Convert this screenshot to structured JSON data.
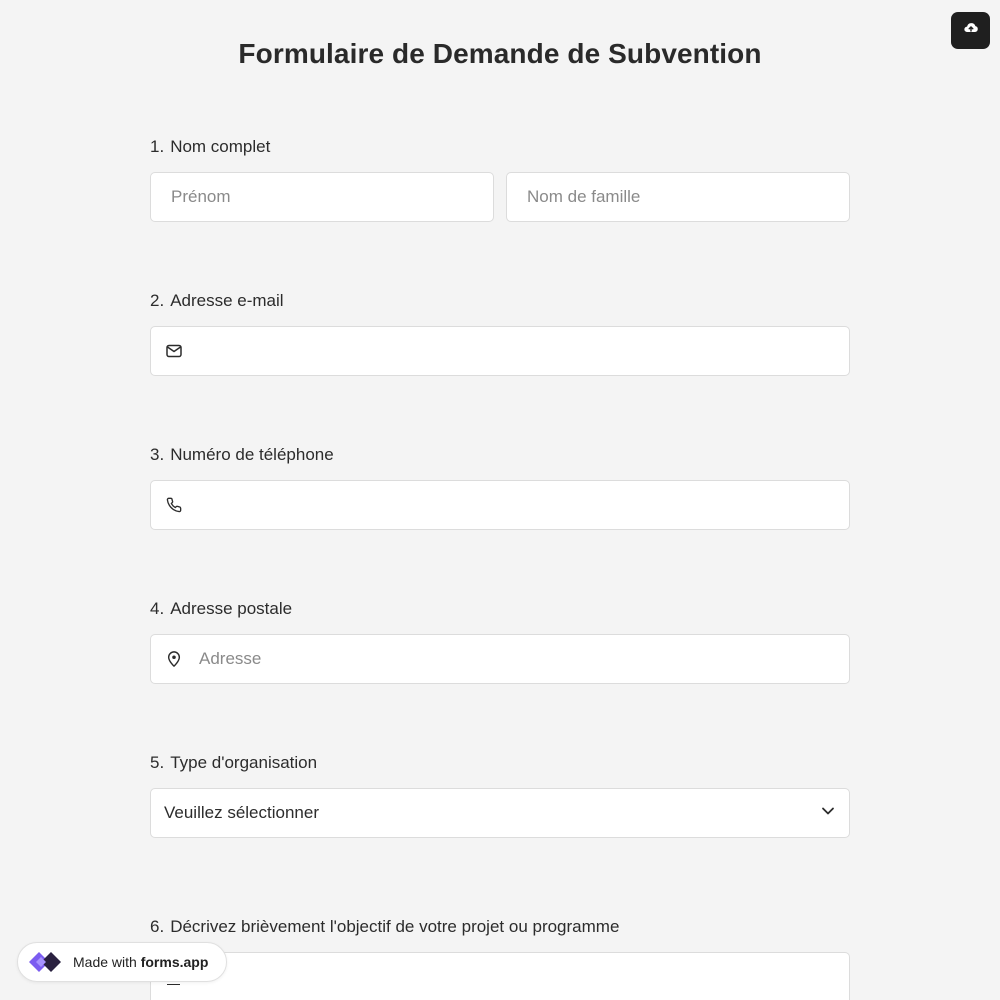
{
  "header": {
    "title": "Formulaire de Demande de Subvention",
    "upload_icon": "cloud-upload-icon"
  },
  "questions": [
    {
      "number": "1.",
      "label": "Nom complet",
      "fields": [
        {
          "placeholder": "Prénom",
          "value": ""
        },
        {
          "placeholder": "Nom de famille",
          "value": ""
        }
      ]
    },
    {
      "number": "2.",
      "label": "Adresse e-mail",
      "icon": "mail-icon",
      "value": ""
    },
    {
      "number": "3.",
      "label": "Numéro de téléphone",
      "icon": "phone-icon",
      "value": ""
    },
    {
      "number": "4.",
      "label": "Adresse postale",
      "icon": "map-pin-icon",
      "placeholder": "Adresse"
    },
    {
      "number": "5.",
      "label": "Type d'organisation",
      "selected": "Veuillez sélectionner",
      "icon": "chevron-down-icon"
    },
    {
      "number": "6.",
      "label": "Décrivez brièvement l'objectif de votre projet ou programme"
    }
  ],
  "footer_badge": {
    "prefix": "Made with",
    "brand": "forms.app"
  },
  "colors": {
    "background": "#f4f4f4",
    "field_bg": "#ffffff",
    "border": "#dcdcdc",
    "placeholder": "#8a8a8a",
    "text": "#2c2c2c",
    "brand_purple": "#7b5cf0"
  }
}
